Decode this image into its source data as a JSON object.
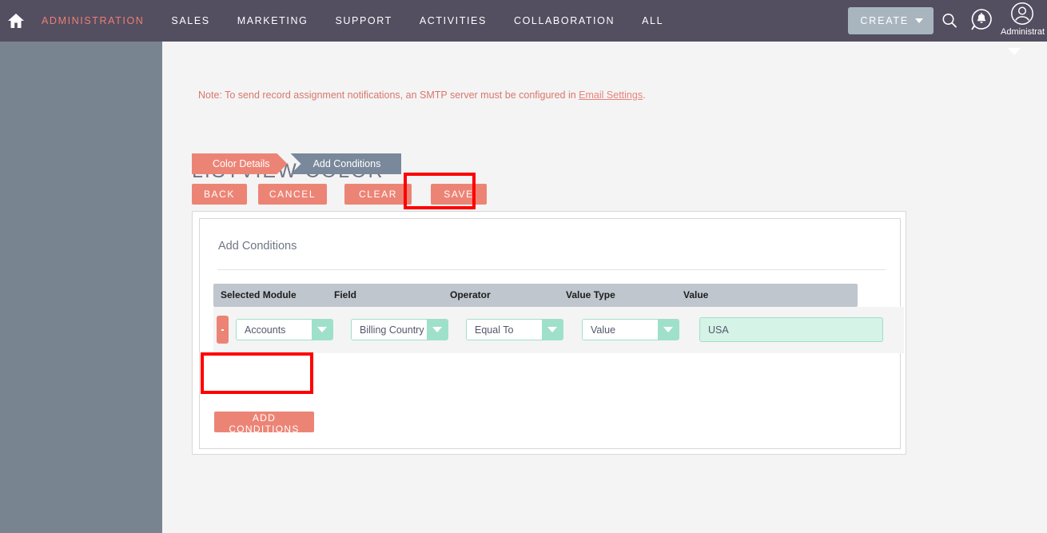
{
  "topnav": {
    "home_icon": "home-icon",
    "items": [
      {
        "label": "ADMINISTRATION",
        "active": true
      },
      {
        "label": "SALES",
        "active": false
      },
      {
        "label": "MARKETING",
        "active": false
      },
      {
        "label": "SUPPORT",
        "active": false
      },
      {
        "label": "ACTIVITIES",
        "active": false
      },
      {
        "label": "COLLABORATION",
        "active": false
      },
      {
        "label": "ALL",
        "active": false
      }
    ],
    "create_label": "CREATE",
    "search_icon": "search-icon",
    "notification_icon": "notification-bell-icon",
    "avatar_icon": "user-avatar-icon",
    "user_name": "Administrat"
  },
  "sidebar": {
    "collapse_icon": "chevron-left-icon"
  },
  "note": {
    "text_before": "Note: To send record assignment notifications, an SMTP server must be configured in ",
    "link": "Email Settings",
    "text_after": "."
  },
  "page": {
    "title": "LISTVIEW COLOR"
  },
  "breadcrumb": {
    "steps": [
      {
        "label": "Color Details",
        "active": false
      },
      {
        "label": "Add Conditions",
        "active": true
      }
    ]
  },
  "actions": {
    "back": "BACK",
    "cancel": "CANCEL",
    "clear": "CLEAR",
    "save": "SAVE"
  },
  "panel": {
    "heading": "Add Conditions",
    "add_conditions_label": "ADD CONDITIONS"
  },
  "table": {
    "columns": [
      "Selected Module",
      "Field",
      "Operator",
      "Value Type",
      "Value"
    ],
    "rows": [
      {
        "selected_module": "Accounts",
        "field": "Billing Country",
        "operator": "Equal To",
        "value_type": "Value",
        "value": "USA",
        "delete_icon": "minus-icon"
      }
    ]
  },
  "colors": {
    "topbar": "#544e61",
    "accent_salmon": "#ec8476",
    "sidebar": "#78848f",
    "step_active": "#79889a",
    "dropdown_mint": "#9fe0ca",
    "value_field": "#d5f3e7",
    "table_header": "#bfc6cd",
    "annotation_red": "#fe0000"
  }
}
